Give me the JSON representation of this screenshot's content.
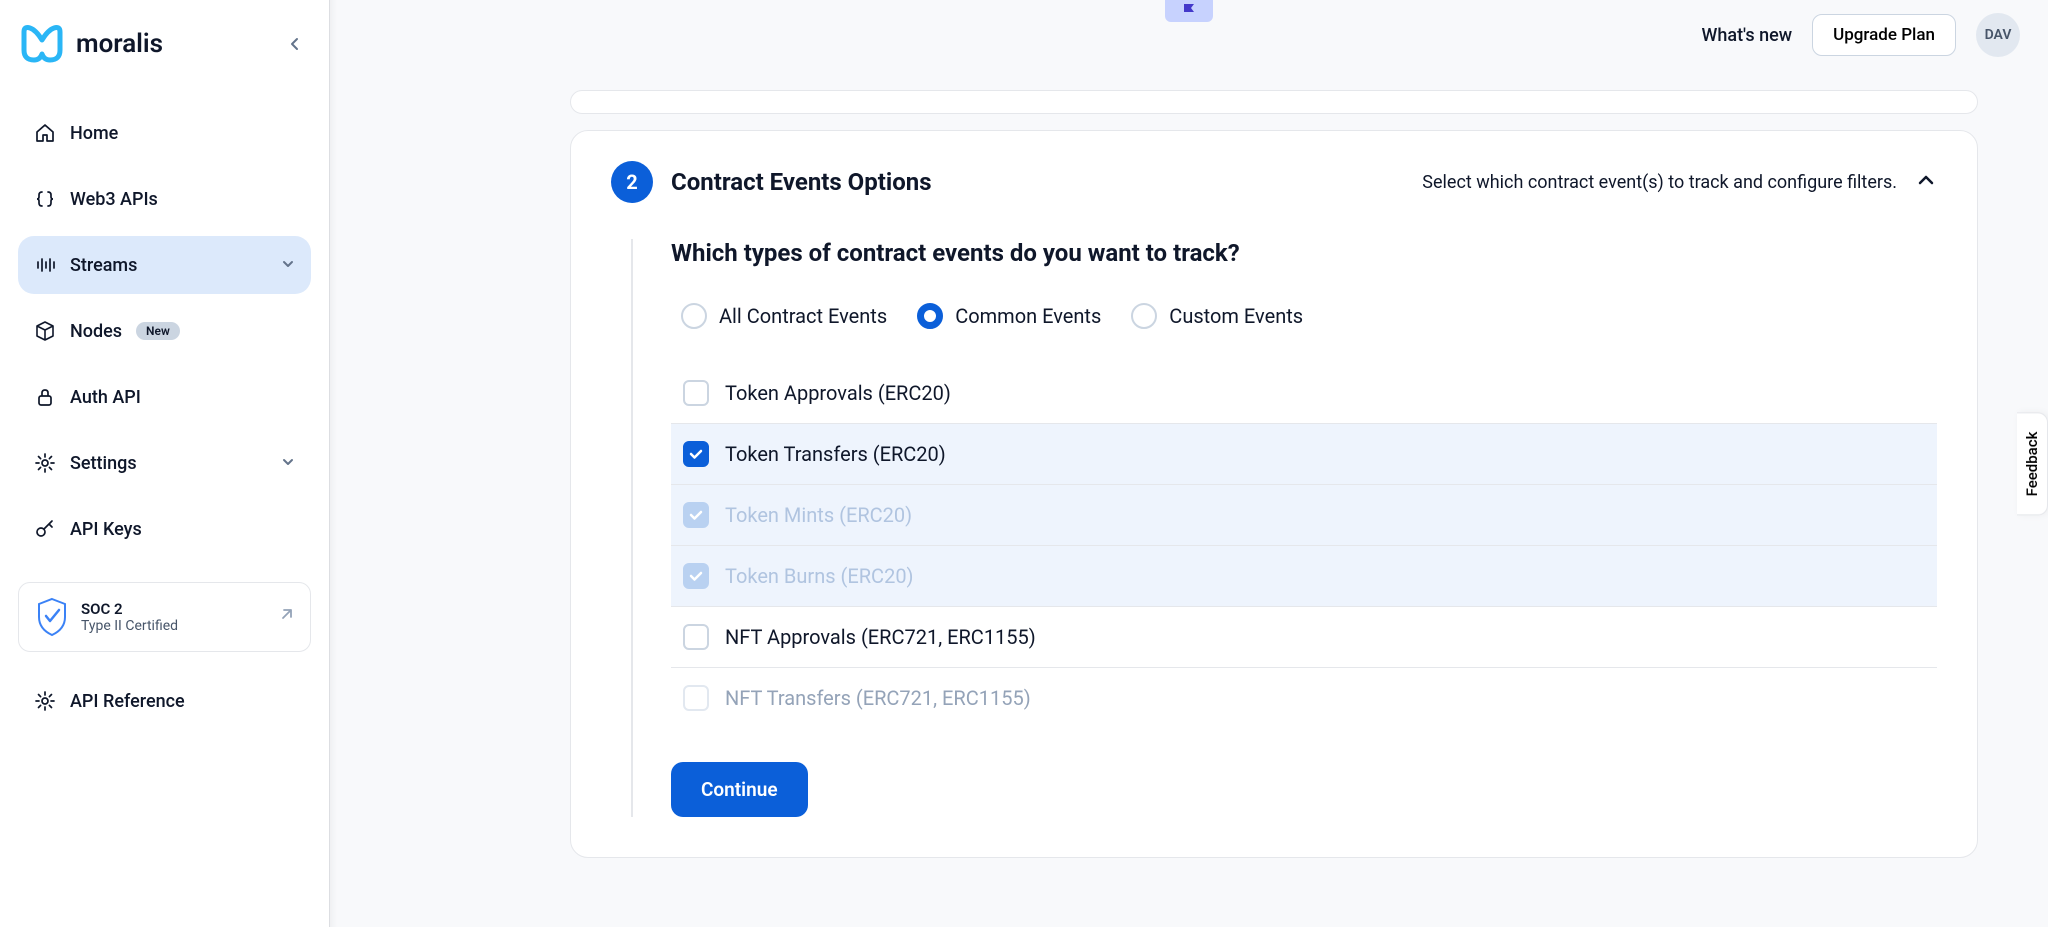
{
  "brand": "moralis",
  "sidebar": {
    "items": [
      {
        "label": "Home"
      },
      {
        "label": "Web3 APIs"
      },
      {
        "label": "Streams"
      },
      {
        "label": "Nodes",
        "badge": "New"
      },
      {
        "label": "Auth API"
      },
      {
        "label": "Settings"
      },
      {
        "label": "API Keys"
      }
    ],
    "soc": {
      "title": "SOC 2",
      "sub": "Type II Certified"
    },
    "api_ref": "API Reference"
  },
  "topbar": {
    "whats_new": "What's new",
    "upgrade": "Upgrade Plan",
    "avatar": "DAV"
  },
  "card": {
    "step": "2",
    "title": "Contract Events Options",
    "desc": "Select which contract event(s) to track and configure filters.",
    "question": "Which types of contract events do you want to track?",
    "radios": [
      {
        "label": "All Contract Events"
      },
      {
        "label": "Common Events"
      },
      {
        "label": "Custom Events"
      }
    ],
    "checks": [
      {
        "label": "Token Approvals (ERC20)"
      },
      {
        "label": "Token Transfers (ERC20)"
      },
      {
        "label": "Token Mints (ERC20)"
      },
      {
        "label": "Token Burns (ERC20)"
      },
      {
        "label": "NFT Approvals (ERC721, ERC1155)"
      },
      {
        "label": "NFT Transfers (ERC721, ERC1155)"
      }
    ],
    "continue": "Continue"
  },
  "feedback": "Feedback"
}
